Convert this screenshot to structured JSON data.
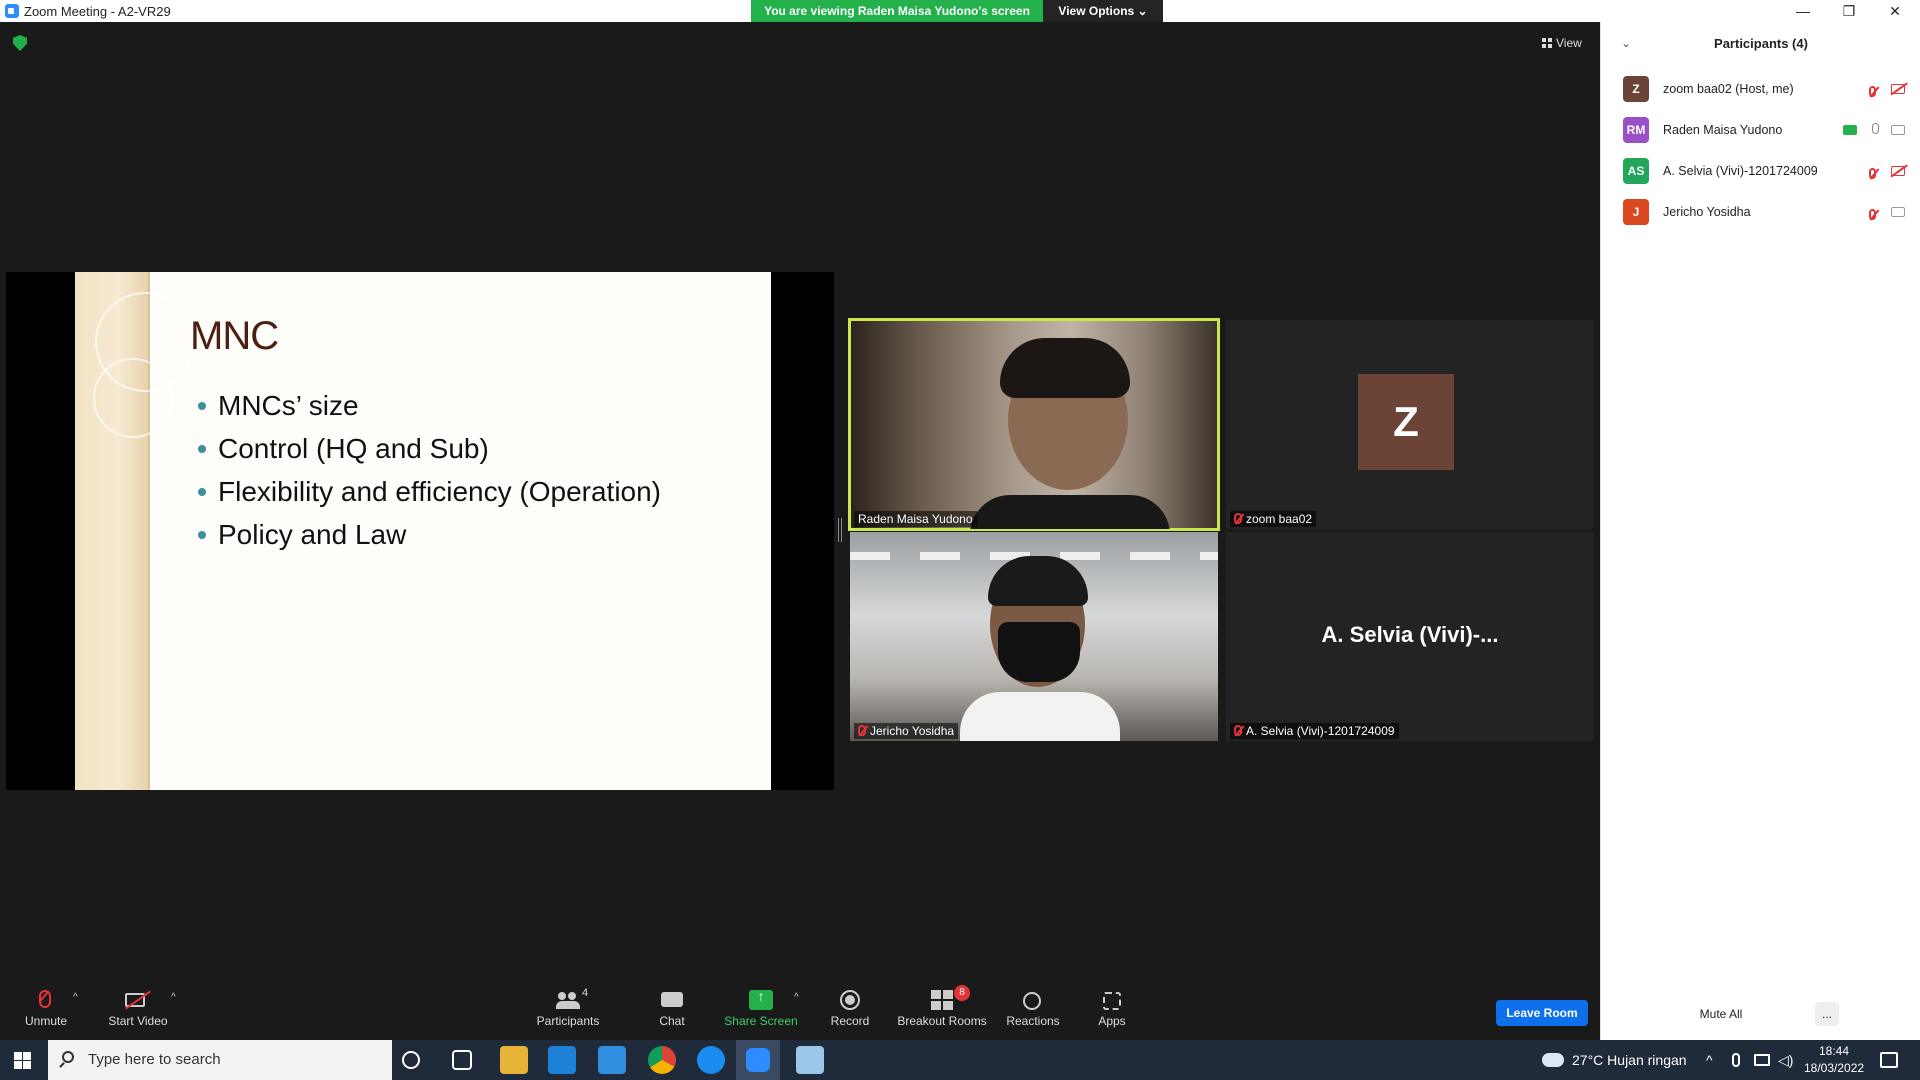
{
  "window": {
    "title": "Zoom Meeting - A2-VR29",
    "viewing_banner": "You are viewing Raden Maisa Yudono's screen",
    "view_options": "View Options ⌄",
    "minimize": "—",
    "restore": "❐",
    "close": "✕"
  },
  "meeting": {
    "view_label": "View",
    "slide": {
      "title": "MNC",
      "bullets": [
        "MNCs’ size",
        "Control (HQ and Sub)",
        "Flexibility and efficiency (Operation)",
        "Policy and Law"
      ]
    },
    "tiles": [
      {
        "name": "Raden Maisa Yudono",
        "active": true,
        "muted": false
      },
      {
        "name": "zoom baa02",
        "avatar_letter": "Z",
        "muted": true
      },
      {
        "name": "Jericho Yosidha",
        "muted": true
      },
      {
        "name": "A. Selvia (Vivi)-1201724009",
        "display_name": "A. Selvia (Vivi)-...",
        "muted": true
      }
    ]
  },
  "toolbar": {
    "unmute": "Unmute",
    "start_video": "Start Video",
    "participants": "Participants",
    "participants_count": "4",
    "chat": "Chat",
    "share_screen": "Share Screen",
    "record": "Record",
    "breakout_rooms": "Breakout Rooms",
    "breakout_badge": "8",
    "reactions": "Reactions",
    "apps": "Apps",
    "leave_room": "Leave Room",
    "caret": "^"
  },
  "participants_panel": {
    "title": "Participants (4)",
    "collapse": "⌄",
    "items": [
      {
        "initials": "Z",
        "name": "zoom baa02 (Host, me)",
        "color": "#6b4437"
      },
      {
        "initials": "RM",
        "name": "Raden Maisa Yudono",
        "color": "#9b4fc6"
      },
      {
        "initials": "AS",
        "name": "A. Selvia (Vivi)-1201724009",
        "color": "#23a55a"
      },
      {
        "initials": "J",
        "name": "Jericho Yosidha",
        "color": "#d9481f"
      }
    ],
    "mute_all": "Mute All",
    "more": "..."
  },
  "taskbar": {
    "search_placeholder": "Type here to search",
    "weather": "27°C  Hujan ringan",
    "time": "18:44",
    "date": "18/03/2022"
  },
  "colors": {
    "active_speaker": "#c9e84a",
    "banner_green": "#24b14c",
    "leave_blue": "#0e71eb",
    "muted_red": "#e4343a"
  }
}
